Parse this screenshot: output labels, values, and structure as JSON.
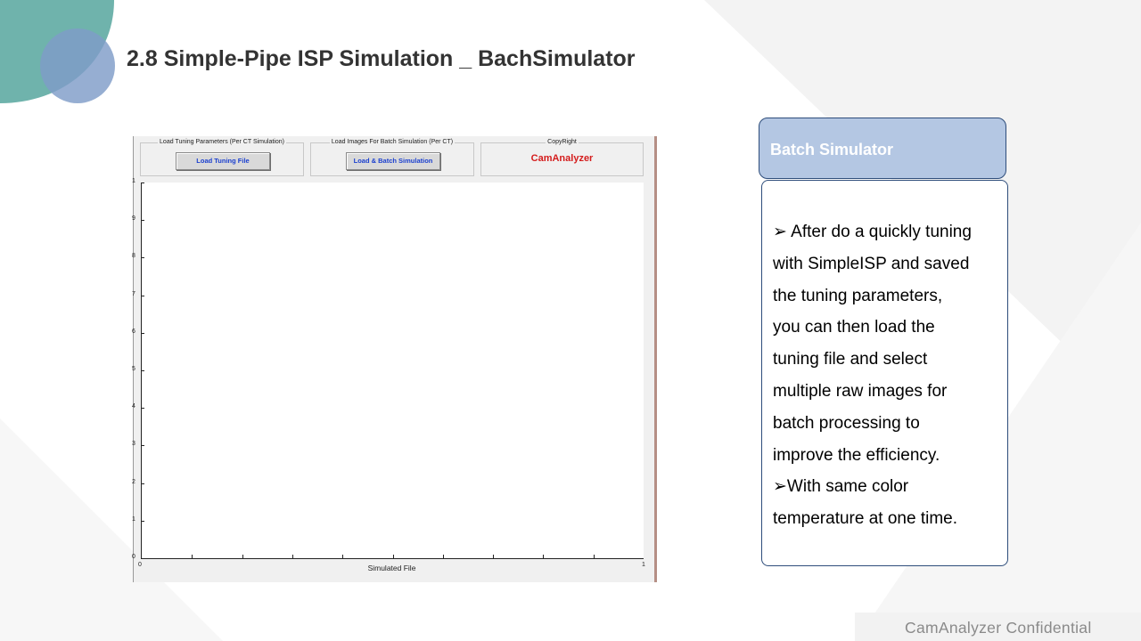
{
  "slide": {
    "title": "2.8  Simple-Pipe ISP Simulation _ BachSimulator",
    "footer": "CamAnalyzer  Confidential"
  },
  "colors": {
    "accent_teal": "#6fb3ac",
    "accent_blue": "#7f9cc8",
    "panel_header": "#b4c7e3",
    "panel_border": "#2e4d7b",
    "button_text": "#1a3fcf",
    "brand_text": "#d41c1c"
  },
  "app": {
    "groups": [
      {
        "label": "Load Tuning Parameters (Per CT Simulation)",
        "button": "Load Tuning File"
      },
      {
        "label": "Load Images For Batch Simulation (Per CT)",
        "button": "Load & Batch Simulation"
      },
      {
        "label": "CopyRight",
        "brand": "CamAnalyzer"
      }
    ],
    "plot": {
      "xlabel": "Simulated File",
      "y_tick_labels": [
        "1",
        "9",
        "8",
        "7",
        "6",
        "5",
        "4",
        "3",
        "2",
        "1",
        "0"
      ],
      "x_tick_labels": [
        "0",
        "1"
      ]
    }
  },
  "panel": {
    "header": "Batch Simulator",
    "lines": [
      "➢ After do a quickly tuning",
      "with SimpleISP and saved",
      "the tuning parameters,",
      "you can then load the",
      "tuning file and select",
      "multiple  raw images for",
      "batch processing to",
      "improve the efficiency.",
      "➢With same color",
      "temperature at one time."
    ]
  }
}
